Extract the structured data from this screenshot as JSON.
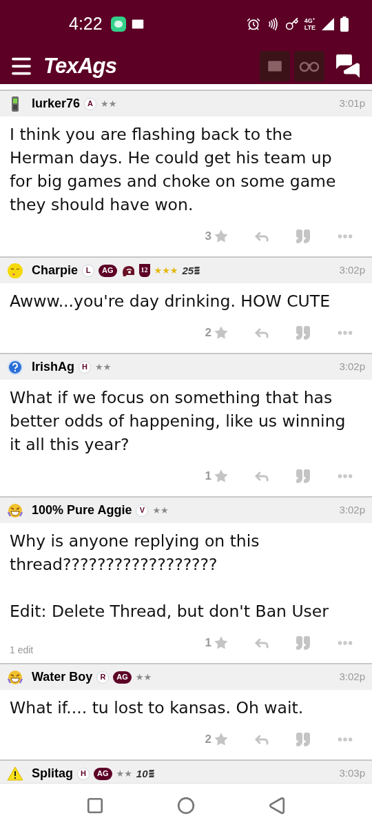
{
  "status_bar": {
    "time": "4:22",
    "network": "4G⁺",
    "network_sub": "LTE"
  },
  "app_bar": {
    "logo": "TexAgs"
  },
  "posts": [
    {
      "avatar": {
        "kind": "phone"
      },
      "user": "lurker76",
      "badges": [
        {
          "kind": "letter",
          "text": "A"
        },
        {
          "kind": "rank",
          "text": "★★",
          "gold": false
        }
      ],
      "time": "3:01p",
      "body": [
        "I think you are flashing back to the Herman days. He could get his team up for big games and choke on some game they should have won."
      ],
      "stars_count": "3"
    },
    {
      "avatar": {
        "kind": "smiley"
      },
      "user": "Charpie",
      "badges": [
        {
          "kind": "letter",
          "text": "L"
        },
        {
          "kind": "ag",
          "text": "AG"
        },
        {
          "kind": "helmet"
        },
        {
          "kind": "shield",
          "text": "12"
        },
        {
          "kind": "rank",
          "text": "★★★",
          "gold": true
        },
        {
          "kind": "years",
          "text": "25"
        }
      ],
      "time": "3:02p",
      "body": [
        "Awww...you're day drinking. HOW CUTE"
      ],
      "stars_count": "2"
    },
    {
      "avatar": {
        "kind": "question"
      },
      "user": "IrishAg",
      "badges": [
        {
          "kind": "letter",
          "text": "H"
        },
        {
          "kind": "rank",
          "text": "★★",
          "gold": false
        }
      ],
      "time": "3:02p",
      "body": [
        "What if we focus on something that has better odds of happening, like us winning it all this year?"
      ],
      "stars_count": "1"
    },
    {
      "avatar": {
        "kind": "laughing"
      },
      "user": "100% Pure Aggie",
      "badges": [
        {
          "kind": "letter",
          "text": "V"
        },
        {
          "kind": "rank",
          "text": "★★",
          "gold": false
        }
      ],
      "time": "3:02p",
      "body": [
        "Why is anyone replying on this thread??????????????????",
        "Edit: Delete Thread, but don't Ban User"
      ],
      "edit_note": "1 edit",
      "stars_count": "1"
    },
    {
      "avatar": {
        "kind": "laughing"
      },
      "user": "Water Boy",
      "badges": [
        {
          "kind": "letter",
          "text": "R"
        },
        {
          "kind": "ag",
          "text": "AG"
        },
        {
          "kind": "rank",
          "text": "★★",
          "gold": false
        }
      ],
      "time": "3:02p",
      "body": [
        "What if.... tu lost to kansas. Oh wait."
      ],
      "stars_count": "2"
    },
    {
      "avatar": {
        "kind": "warning"
      },
      "user": "Splitag",
      "badges": [
        {
          "kind": "letter",
          "text": "H"
        },
        {
          "kind": "ag",
          "text": "AG"
        },
        {
          "kind": "rank",
          "text": "★★",
          "gold": false
        },
        {
          "kind": "years",
          "text": "10"
        }
      ],
      "time": "3:03p"
    }
  ]
}
